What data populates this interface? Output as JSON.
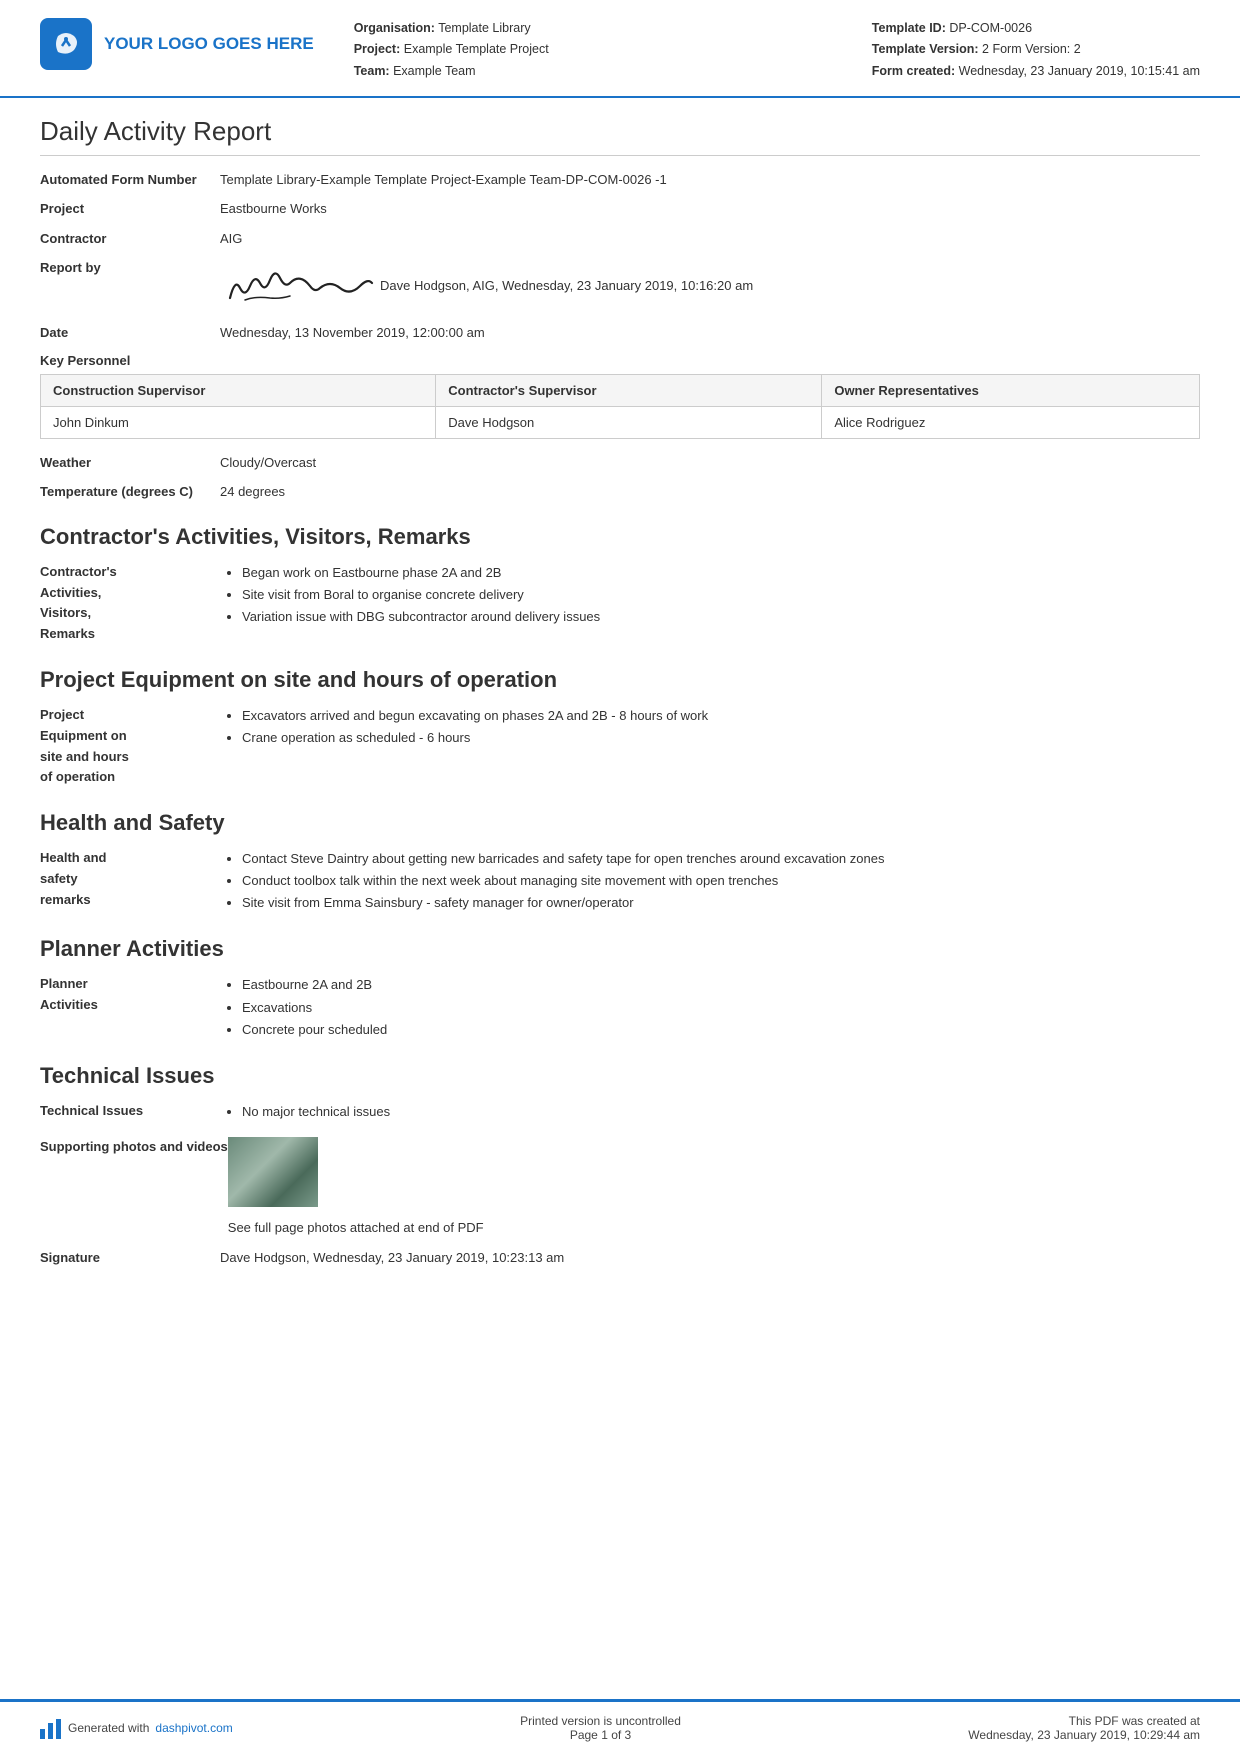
{
  "header": {
    "logo_text": "YOUR LOGO GOES HERE",
    "org_label": "Organisation:",
    "org_value": "Template Library",
    "project_label": "Project:",
    "project_value": "Example Template Project",
    "team_label": "Team:",
    "team_value": "Example Team",
    "template_id_label": "Template ID:",
    "template_id_value": "DP-COM-0026",
    "template_version_label": "Template Version:",
    "template_version_value": "2 Form Version: 2",
    "form_created_label": "Form created:",
    "form_created_value": "Wednesday, 23 January 2019, 10:15:41 am"
  },
  "report": {
    "title": "Daily Activity Report",
    "automated_form_number_label": "Automated Form Number",
    "automated_form_number_value": "Template Library-Example Template Project-Example Team-DP-COM-0026   -1",
    "project_label": "Project",
    "project_value": "Eastbourne Works",
    "contractor_label": "Contractor",
    "contractor_value": "AIG",
    "report_by_label": "Report by",
    "report_by_value": "Dave Hodgson, AIG, Wednesday, 23 January 2019, 10:16:20 am",
    "date_label": "Date",
    "date_value": "Wednesday, 13 November 2019, 12:00:00 am"
  },
  "key_personnel": {
    "section_label": "Key Personnel",
    "columns": [
      "Construction Supervisor",
      "Contractor's Supervisor",
      "Owner Representatives"
    ],
    "row": [
      "John Dinkum",
      "Dave Hodgson",
      "Alice Rodriguez"
    ]
  },
  "weather": {
    "label": "Weather",
    "value": "Cloudy/Overcast",
    "temp_label": "Temperature (degrees C)",
    "temp_value": "24 degrees"
  },
  "contractors_activities": {
    "heading": "Contractor's Activities, Visitors, Remarks",
    "label": "Contractor's Activities, Visitors, Remarks",
    "items": [
      "Began work on Eastbourne phase 2A and 2B",
      "Site visit from Boral to organise concrete delivery",
      "Variation issue with DBG subcontractor around delivery issues"
    ]
  },
  "project_equipment": {
    "heading": "Project Equipment on site and hours of operation",
    "label": "Project Equipment on site and hours of operation",
    "items": [
      "Excavators arrived and begun excavating on phases 2A and 2B - 8 hours of work",
      "Crane operation as scheduled - 6 hours"
    ]
  },
  "health_safety": {
    "heading": "Health and Safety",
    "label": "Health and safety remarks",
    "items": [
      "Contact Steve Daintry about getting new barricades and safety tape for open trenches around excavation zones",
      "Conduct toolbox talk within the next week about managing site movement with open trenches",
      "Site visit from Emma Sainsbury - safety manager for owner/operator"
    ]
  },
  "planner_activities": {
    "heading": "Planner Activities",
    "label": "Planner Activities",
    "items": [
      "Eastbourne 2A and 2B",
      "Excavations",
      "Concrete pour scheduled"
    ]
  },
  "technical_issues": {
    "heading": "Technical Issues",
    "label": "Technical Issues",
    "items": [
      "No major technical issues"
    ],
    "supporting_label": "Supporting photos and videos",
    "photo_caption": "See full page photos attached at end of PDF"
  },
  "signature": {
    "label": "Signature",
    "value": "Dave Hodgson, Wednesday, 23 January 2019, 10:23:13 am"
  },
  "footer": {
    "generated_text": "Generated with ",
    "link_text": "dashpivot.com",
    "uncontrolled_text": "Printed version is uncontrolled",
    "page_text": "Page 1 of 3",
    "pdf_created_label": "This PDF was created at",
    "pdf_created_value": "Wednesday, 23 January 2019, 10:29:44 am"
  }
}
